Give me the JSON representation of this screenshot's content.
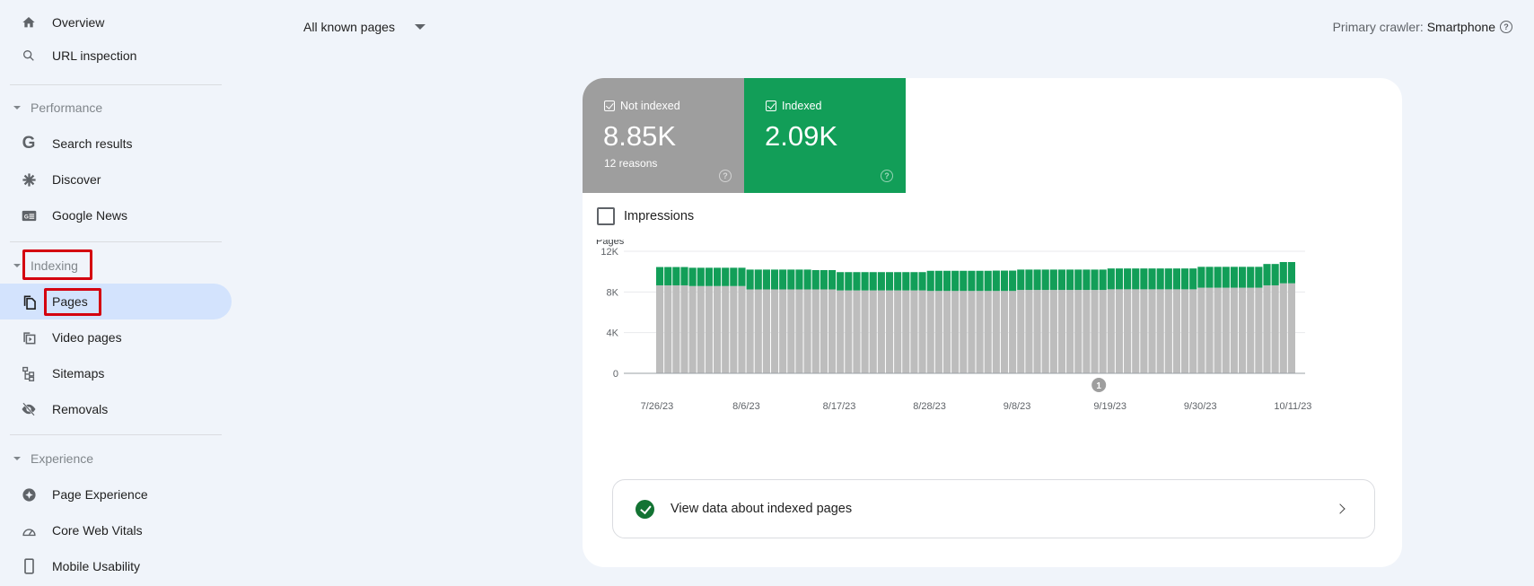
{
  "sidebar": {
    "top_items": [
      {
        "label": "Overview",
        "icon": "home-icon"
      },
      {
        "label": "URL inspection",
        "icon": "search-icon"
      }
    ],
    "sections": [
      {
        "title": "Performance",
        "items": [
          {
            "label": "Search results",
            "icon": "google-g-icon"
          },
          {
            "label": "Discover",
            "icon": "asterisk-icon"
          },
          {
            "label": "Google News",
            "icon": "google-news-icon"
          }
        ]
      },
      {
        "title": "Indexing",
        "highlighted": true,
        "items": [
          {
            "label": "Pages",
            "icon": "pages-icon",
            "active": true,
            "highlighted": true
          },
          {
            "label": "Video pages",
            "icon": "video-pages-icon"
          },
          {
            "label": "Sitemaps",
            "icon": "sitemap-icon"
          },
          {
            "label": "Removals",
            "icon": "eye-off-icon"
          }
        ]
      },
      {
        "title": "Experience",
        "items": [
          {
            "label": "Page Experience",
            "icon": "page-experience-icon"
          },
          {
            "label": "Core Web Vitals",
            "icon": "gauge-icon"
          },
          {
            "label": "Mobile Usability",
            "icon": "phone-icon"
          }
        ]
      }
    ]
  },
  "header": {
    "page_filter": "All known pages",
    "crawler_label": "Primary crawler:",
    "crawler_value": "Smartphone",
    "help_glyph": "?"
  },
  "summary": {
    "not_indexed": {
      "label": "Not indexed",
      "value": "8.85K",
      "sub": "12 reasons",
      "checked": true,
      "color": "#9e9e9e"
    },
    "indexed": {
      "label": "Indexed",
      "value": "2.09K",
      "checked": true,
      "color": "#129e58"
    }
  },
  "impressions": {
    "label": "Impressions",
    "checked": false
  },
  "view_link": {
    "label": "View data about indexed pages"
  },
  "chart_data": {
    "type": "bar",
    "stacked": true,
    "ylabel": "Pages",
    "ylim": [
      0,
      12000
    ],
    "yticks": [
      {
        "value": 0,
        "label": "0"
      },
      {
        "value": 4000,
        "label": "4K"
      },
      {
        "value": 8000,
        "label": "8K"
      },
      {
        "value": 12000,
        "label": "12K"
      }
    ],
    "xtick_labels": [
      "7/26/23",
      "8/6/23",
      "8/17/23",
      "8/28/23",
      "9/8/23",
      "9/19/23",
      "9/30/23",
      "10/11/23"
    ],
    "xtick_every": 11,
    "grid": true,
    "annotations": [
      {
        "label": "1",
        "bar_index": 54
      }
    ],
    "series": [
      {
        "name": "Not indexed",
        "color": "#bdbdbd",
        "values": [
          8650,
          8650,
          8650,
          8650,
          8580,
          8580,
          8580,
          8580,
          8580,
          8580,
          8580,
          8250,
          8250,
          8250,
          8250,
          8250,
          8250,
          8250,
          8250,
          8250,
          8250,
          8250,
          8150,
          8150,
          8150,
          8150,
          8150,
          8150,
          8150,
          8150,
          8150,
          8150,
          8150,
          8100,
          8100,
          8100,
          8100,
          8100,
          8100,
          8100,
          8100,
          8100,
          8100,
          8100,
          8200,
          8200,
          8200,
          8200,
          8200,
          8200,
          8200,
          8200,
          8200,
          8200,
          8200,
          8260,
          8260,
          8260,
          8260,
          8260,
          8260,
          8260,
          8260,
          8260,
          8260,
          8260,
          8420,
          8420,
          8420,
          8420,
          8420,
          8420,
          8420,
          8420,
          8650,
          8650,
          8850,
          8850
        ]
      },
      {
        "name": "Indexed",
        "color": "#129e58",
        "values": [
          1800,
          1800,
          1800,
          1800,
          1800,
          1800,
          1800,
          1800,
          1800,
          1800,
          1800,
          1950,
          1950,
          1950,
          1950,
          1950,
          1950,
          1950,
          1950,
          1900,
          1900,
          1900,
          1800,
          1800,
          1800,
          1800,
          1800,
          1800,
          1800,
          1800,
          1800,
          1800,
          1800,
          1980,
          1980,
          1980,
          1980,
          1980,
          1980,
          1980,
          1980,
          2000,
          2000,
          2000,
          2000,
          2000,
          2000,
          2000,
          2000,
          2000,
          2000,
          2000,
          2000,
          2000,
          2000,
          2050,
          2050,
          2050,
          2050,
          2050,
          2050,
          2050,
          2050,
          2050,
          2050,
          2050,
          2050,
          2050,
          2050,
          2050,
          2050,
          2050,
          2050,
          2050,
          2100,
          2100,
          2090,
          2090
        ]
      }
    ]
  }
}
